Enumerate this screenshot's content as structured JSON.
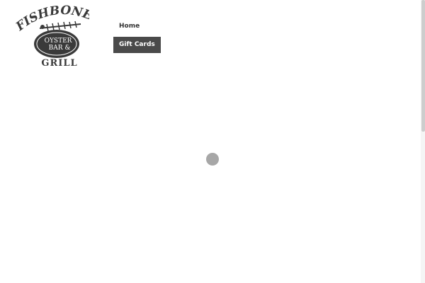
{
  "logo": {
    "line1": "FISHBONES",
    "oval_line1": "OYSTER",
    "oval_line2": "BAR &",
    "line2": "GRILL"
  },
  "nav": {
    "items": [
      {
        "label": "Home",
        "active": false
      },
      {
        "label": "Gift Cards",
        "active": true
      }
    ]
  },
  "colors": {
    "nav_active_bg": "#4a4a4a",
    "spinner": "#a7a7a7",
    "text": "#333333"
  },
  "icons": {
    "loading": "loading-spinner-icon"
  }
}
